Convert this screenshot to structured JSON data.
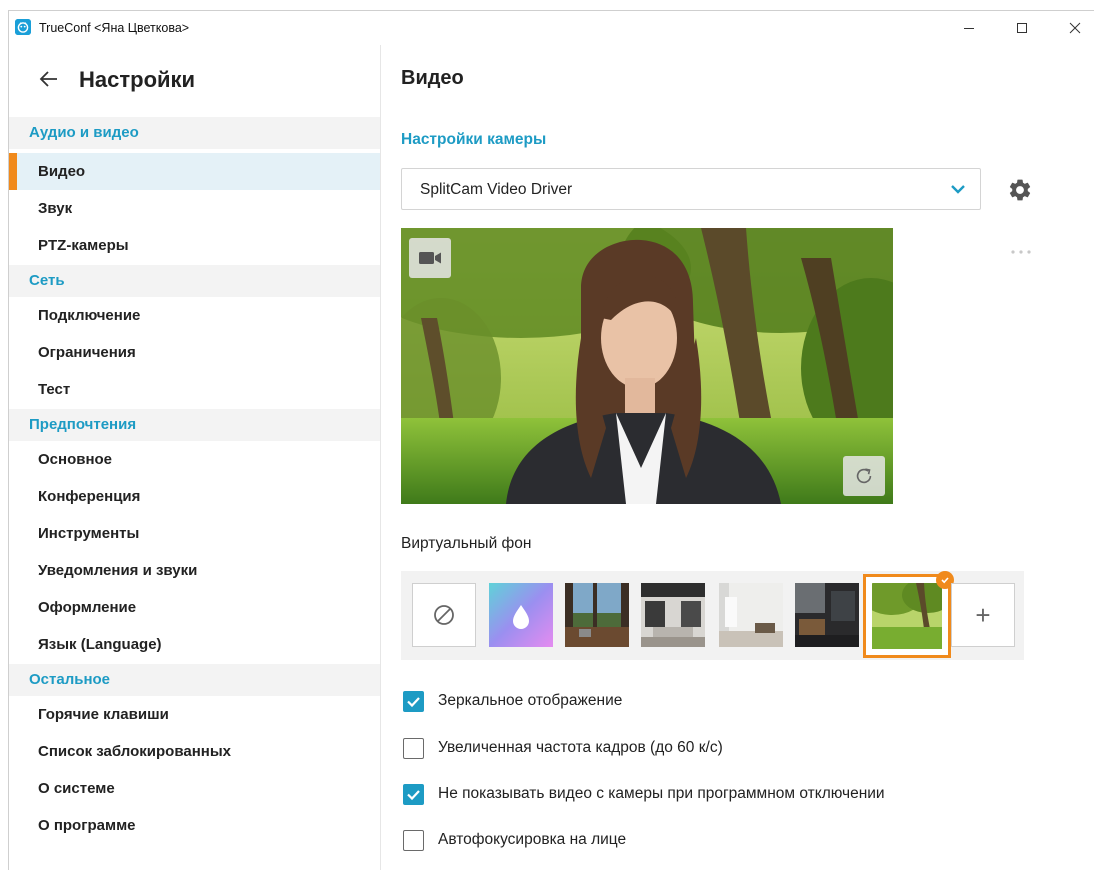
{
  "window": {
    "title": "TrueConf <Яна Цветкова>"
  },
  "sidebar": {
    "title": "Настройки",
    "groups": [
      {
        "label": "Аудио и видео",
        "items": [
          {
            "label": "Видео",
            "active": true
          },
          {
            "label": "Звук"
          },
          {
            "label": "PTZ-камеры"
          }
        ]
      },
      {
        "label": "Сеть",
        "items": [
          {
            "label": "Подключение"
          },
          {
            "label": "Ограничения"
          },
          {
            "label": "Тест"
          }
        ]
      },
      {
        "label": "Предпочтения",
        "items": [
          {
            "label": "Основное"
          },
          {
            "label": "Конференция"
          },
          {
            "label": "Инструменты"
          },
          {
            "label": "Уведомления и звуки"
          },
          {
            "label": "Оформление"
          },
          {
            "label": "Язык (Language)"
          }
        ]
      },
      {
        "label": "Остальное",
        "items": [
          {
            "label": "Горячие клавиши"
          },
          {
            "label": "Список заблокированных"
          },
          {
            "label": "О системе"
          },
          {
            "label": "О программе"
          }
        ]
      }
    ]
  },
  "main": {
    "title": "Видео",
    "camera_section_label": "Настройки камеры",
    "camera_select": {
      "value": "SplitCam Video Driver"
    },
    "virtual_background": {
      "label": "Виртуальный фон",
      "add_label": "+",
      "selected_index": 6
    },
    "options": [
      {
        "label": "Зеркальное отображение",
        "checked": true
      },
      {
        "label": "Увеличенная частота кадров (до 60 к/с)",
        "checked": false
      },
      {
        "label": "Не показывать видео с камеры при программном отключении",
        "checked": true
      },
      {
        "label": "Автофокусировка на лице",
        "checked": false
      }
    ]
  },
  "colors": {
    "accent": "#1d9bc4",
    "active_marker": "#f08a1c",
    "active_bg": "#e4f1f7",
    "section_bg": "#f3f3f3"
  }
}
